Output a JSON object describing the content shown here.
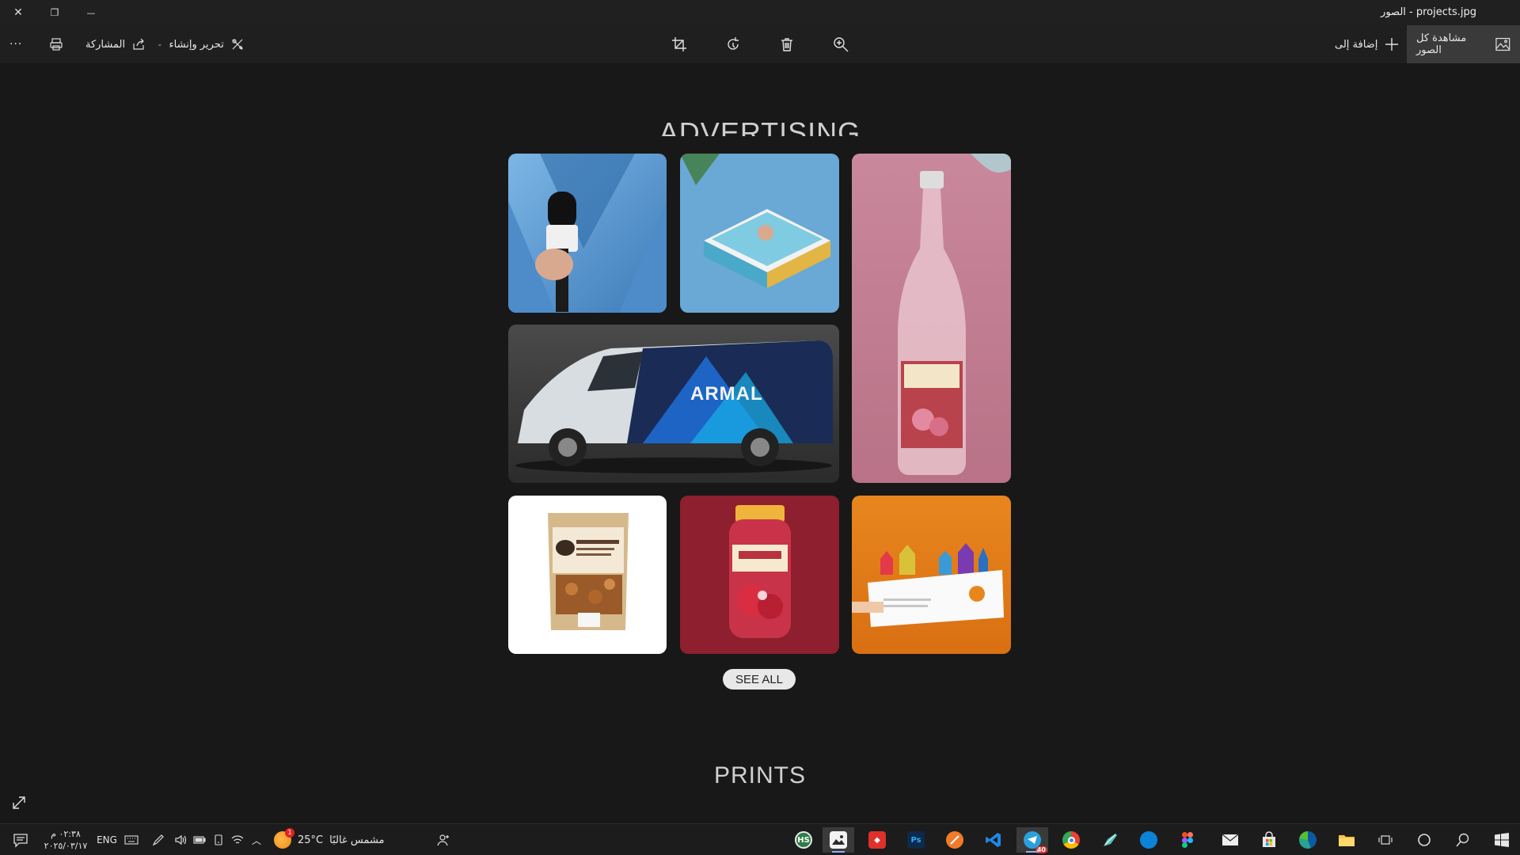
{
  "window": {
    "title": "الصور - projects.jpg",
    "close_label": "✕",
    "restore_label": "❐",
    "minimize_label": "—"
  },
  "toolbar": {
    "view_all_label": "مشاهدة كل الصور",
    "add_to_label": "إضافة إلى",
    "edit_create_label": "تحرير وإنشاء",
    "share_label": "المشاركة",
    "more_label": "···"
  },
  "image": {
    "heading": "ADVERTISING DESIGN",
    "see_all_label": "SEE ALL",
    "section2_heading": "PRINTS",
    "tiles": [
      {
        "name": "microphone-mockup",
        "bg": "#5e9ad0"
      },
      {
        "name": "box-packaging-mockup",
        "bg": "#6aa6d4"
      },
      {
        "name": "bottle-mockup",
        "bg": "#c98a9c"
      },
      {
        "name": "van-branding-mockup",
        "bg": "#3a3a3a",
        "text": "ARMAL"
      },
      {
        "name": "coffee-pouch-mockup",
        "bg": "#ffffff"
      },
      {
        "name": "jar-mockup",
        "bg": "#8e1f2e"
      },
      {
        "name": "business-card-mockup",
        "bg": "#e07a1c"
      }
    ]
  },
  "taskbar": {
    "time": "٠٢:٣٨ م",
    "date": "٢٠٢٥/٠٣/١٧",
    "language": "ENG",
    "weather_temp": "25°C",
    "weather_text": "مشمس غالبًا",
    "weather_badge": "1",
    "apps": [
      {
        "name": "hs-app-icon",
        "label": "HS",
        "color": "#2d7d46"
      },
      {
        "name": "photos-app-icon",
        "label": "",
        "color": "#4a90d9"
      },
      {
        "name": "anydesk-icon",
        "label": "◆",
        "color": "#e0302b"
      },
      {
        "name": "photoshop-icon",
        "label": "Ps",
        "color": "#0d2a4a"
      },
      {
        "name": "swift-icon",
        "label": "",
        "color": "#f27a28"
      },
      {
        "name": "vscode-icon",
        "label": "",
        "color": "#1e88e5"
      },
      {
        "name": "telegram-icon",
        "label": "",
        "color": "#2aa1dc"
      },
      {
        "name": "chrome-icon",
        "label": "",
        "color": "#34a853"
      },
      {
        "name": "pen-app-icon",
        "label": "",
        "color": "#5bc0be"
      },
      {
        "name": "edge-legacy-icon",
        "label": "",
        "color": "#0b84d8"
      },
      {
        "name": "figma-icon",
        "label": "",
        "color": "#a259ff"
      },
      {
        "name": "mail-icon",
        "label": "",
        "color": "#dddddd"
      },
      {
        "name": "store-icon",
        "label": "",
        "color": "#f3b01c"
      },
      {
        "name": "edge-icon",
        "label": "",
        "color": "#26a48f"
      },
      {
        "name": "file-explorer-icon",
        "label": "",
        "color": "#f6c445"
      }
    ],
    "telegram_badge": "40"
  }
}
